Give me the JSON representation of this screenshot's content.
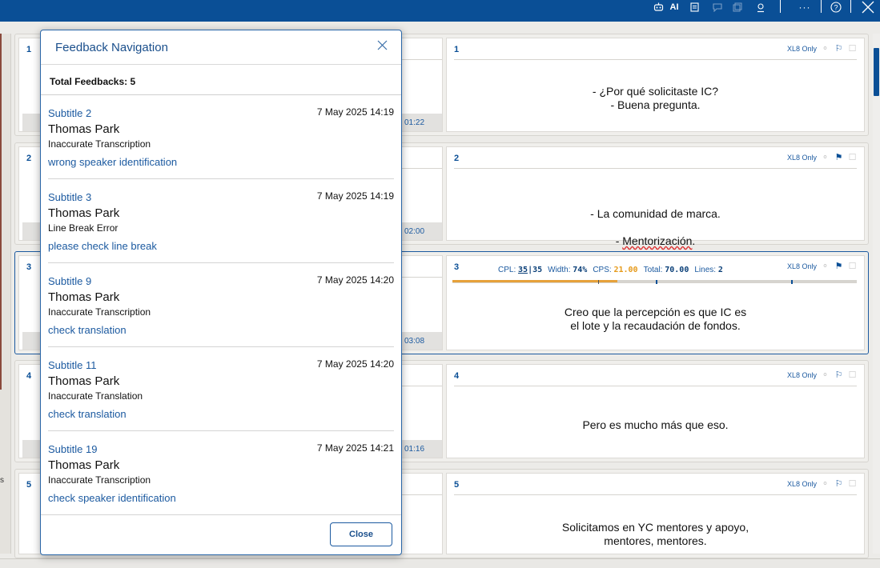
{
  "topbar": {
    "ai_label": "AI",
    "more_label": "···"
  },
  "rows": [
    {
      "num": "1",
      "time": "01:22",
      "target_num": "1",
      "badge": "XL8 Only",
      "text": "- ¿Por qué solicitaste IC?\n- Buena pregunta.",
      "flagged": false
    },
    {
      "num": "2",
      "time": "02:00",
      "target_num": "2",
      "badge": "XL8 Only",
      "text_line1": "- La comunidad de marca.",
      "text_line2_prefix": "- ",
      "text_line2_word": "Mentorización",
      "text_line2_suffix": ".",
      "flagged": true
    },
    {
      "num": "3",
      "time": "03:08",
      "target_num": "3",
      "badge": "XL8 Only",
      "text": "Creo que la percepción es que IC es\nel lote y la recaudación de fondos.",
      "flagged": true,
      "stats": {
        "cpl_label": "CPL:",
        "cpl_value": "35",
        "cpl_max": "35",
        "width_label": "Width:",
        "width_value": "74%",
        "cps_label": "CPS:",
        "cps_value": "21.00",
        "total_label": "Total:",
        "total_value": "70.00",
        "lines_label": "Lines:",
        "lines_value": "2"
      }
    },
    {
      "num": "4",
      "time": "01:16",
      "target_num": "4",
      "badge": "XL8 Only",
      "text": "Pero es mucho más que eso.",
      "flagged": false
    },
    {
      "num": "5",
      "time": "",
      "target_num": "5",
      "badge": "XL8 Only",
      "text": "Solicitamos en YC mentores y apoyo,\nmentores, mentores.",
      "flagged": false
    }
  ],
  "left_strip_mark": "s",
  "modal": {
    "title": "Feedback Navigation",
    "total_label": "Total Feedbacks: 5",
    "close_label": "Close",
    "items": [
      {
        "subtitle": "Subtitle 2",
        "date": "7 May 2025 14:19",
        "user": "Thomas Park",
        "type": "Inaccurate Transcription",
        "comment": "wrong speaker identification"
      },
      {
        "subtitle": "Subtitle 3",
        "date": "7 May 2025 14:19",
        "user": "Thomas Park",
        "type": "Line Break Error",
        "comment": "please check line break"
      },
      {
        "subtitle": "Subtitle 9",
        "date": "7 May 2025 14:20",
        "user": "Thomas Park",
        "type": "Inaccurate Transcription",
        "comment": "check translation"
      },
      {
        "subtitle": "Subtitle 11",
        "date": "7 May 2025 14:20",
        "user": "Thomas Park",
        "type": "Inaccurate Translation",
        "comment": "check translation"
      },
      {
        "subtitle": "Subtitle 19",
        "date": "7 May 2025 14:21",
        "user": "Thomas Park",
        "type": "Inaccurate Transcription",
        "comment": "check speaker identification"
      }
    ]
  }
}
